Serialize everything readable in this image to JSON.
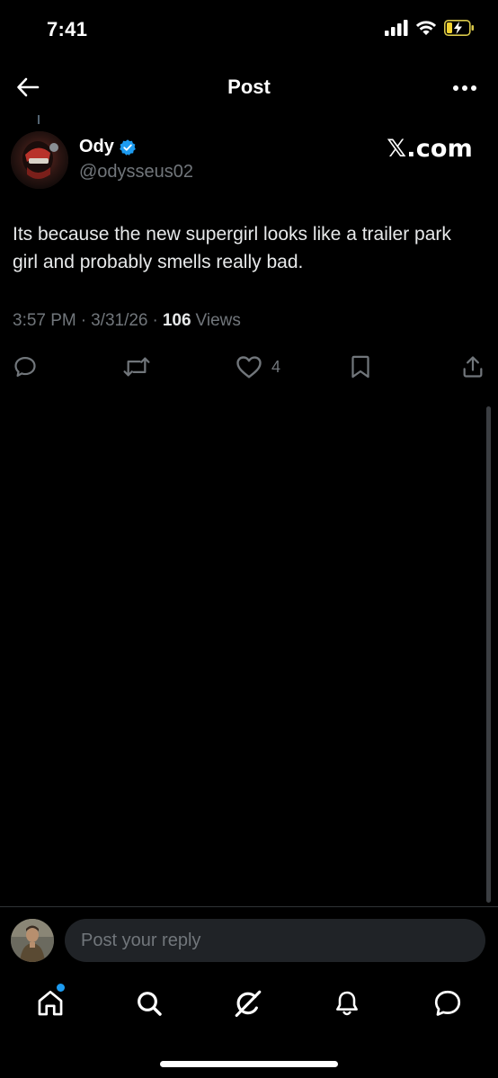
{
  "status_bar": {
    "time": "7:41"
  },
  "header": {
    "title": "Post"
  },
  "post": {
    "author_name": "Ody",
    "author_handle": "@odysseus02",
    "source_label": "𝕏.com",
    "text": "Its because the new supergirl looks like a trailer park girl and probably smells really bad.",
    "time": "3:57 PM",
    "date": "3/31/26",
    "views_count": "106",
    "views_label": "Views",
    "likes_count": "4"
  },
  "reply": {
    "placeholder": "Post your reply"
  },
  "colors": {
    "background": "#000000",
    "accent": "#1d9bf0",
    "muted_text": "#71767b",
    "primary_text": "#e7e9ea"
  },
  "icons": {
    "back": "arrow-left-icon",
    "more": "more-dots-icon",
    "reply": "reply-bubble-icon",
    "repost": "repost-icon",
    "like": "heart-icon",
    "bookmark": "bookmark-icon",
    "share": "share-icon",
    "tabs": [
      "home-icon",
      "search-icon",
      "grok-icon",
      "notifications-icon",
      "messages-icon"
    ]
  }
}
